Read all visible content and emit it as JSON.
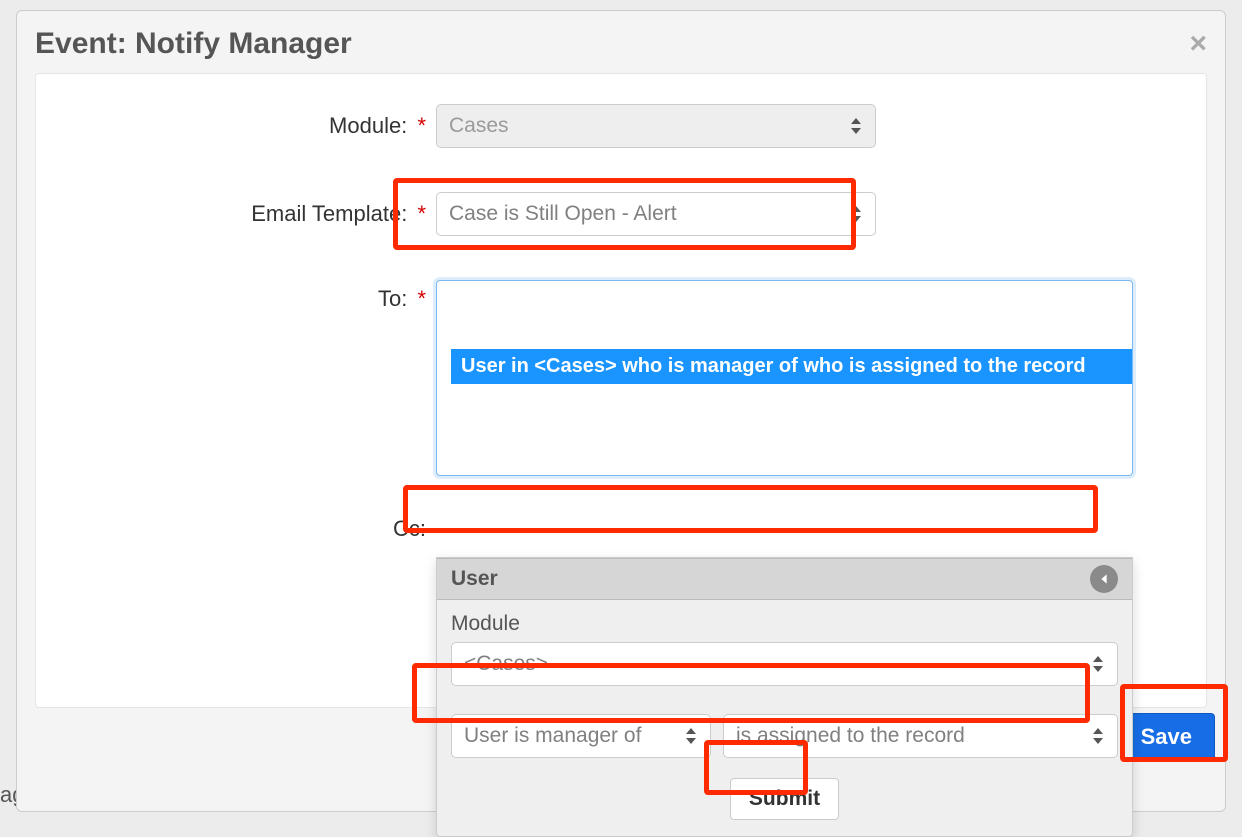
{
  "dialog": {
    "title": "Event: Notify Manager",
    "close_label": "×"
  },
  "form": {
    "module": {
      "label": "Module:",
      "required": "*",
      "value": "Cases"
    },
    "email_template": {
      "label": "Email Template:",
      "required": "*",
      "value": "Case is Still Open - Alert"
    },
    "to": {
      "label": "To:",
      "required": "*",
      "chip": "User in <Cases> who is manager of who is assigned to the record"
    },
    "cc": {
      "label": "Cc:",
      "header": "User",
      "module_label": "Module",
      "module_value": "<Cases>",
      "rel1": "User is manager of",
      "rel2": "is assigned to the record",
      "submit": "Submit"
    }
  },
  "actions": {
    "save": "Save"
  },
  "background": {
    "text": "ager"
  }
}
